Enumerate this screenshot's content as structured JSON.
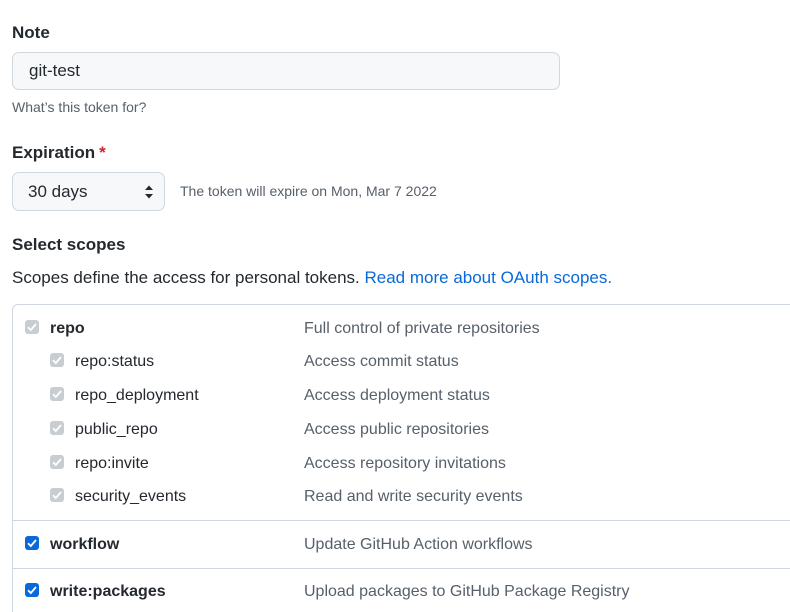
{
  "note": {
    "label": "Note",
    "value": "git-test",
    "hint": "What’s this token for?"
  },
  "expiration": {
    "label": "Expiration",
    "required_mark": "*",
    "selected": "30 days",
    "info": "The token will expire on Mon, Mar 7 2022"
  },
  "scopes": {
    "title": "Select scopes",
    "description": "Scopes define the access for personal tokens.",
    "link_text": "Read more about OAuth scopes.",
    "items": [
      {
        "name": "repo",
        "desc": "Full control of private repositories",
        "state": "disabled-checked"
      },
      {
        "name": "repo:status",
        "desc": "Access commit status",
        "state": "disabled-checked"
      },
      {
        "name": "repo_deployment",
        "desc": "Access deployment status",
        "state": "disabled-checked"
      },
      {
        "name": "public_repo",
        "desc": "Access public repositories",
        "state": "disabled-checked"
      },
      {
        "name": "repo:invite",
        "desc": "Access repository invitations",
        "state": "disabled-checked"
      },
      {
        "name": "security_events",
        "desc": "Read and write security events",
        "state": "disabled-checked"
      },
      {
        "name": "workflow",
        "desc": "Update GitHub Action workflows",
        "state": "checked"
      },
      {
        "name": "write:packages",
        "desc": "Upload packages to GitHub Package Registry",
        "state": "checked"
      }
    ]
  },
  "colors": {
    "accent": "#0969da",
    "required": "#cf222e",
    "border": "#d0d7de",
    "muted_text": "#57606a"
  }
}
